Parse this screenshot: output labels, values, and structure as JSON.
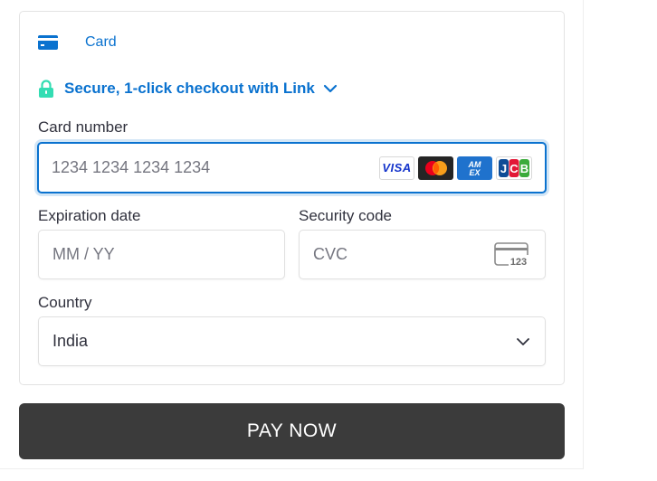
{
  "payment_method": {
    "tab_label": "Card",
    "icon": "credit-card-icon"
  },
  "link": {
    "label": "Secure, 1-click checkout with Link",
    "icon": "lock-icon",
    "expand_icon": "chevron-down-icon"
  },
  "card_number": {
    "label": "Card number",
    "placeholder": "1234 1234 1234 1234",
    "brands": [
      "VISA",
      "Mastercard",
      "American Express",
      "JCB"
    ],
    "brand_texts": {
      "visa": "VISA",
      "amex_top": "AM",
      "amex_bottom": "EX",
      "jcb_j": "J",
      "jcb_c": "C",
      "jcb_b": "B"
    }
  },
  "expiration": {
    "label": "Expiration date",
    "placeholder": "MM / YY"
  },
  "security_code": {
    "label": "Security code",
    "placeholder": "CVC",
    "icon_text": "123"
  },
  "country": {
    "label": "Country",
    "value": "India"
  },
  "pay_button": {
    "label": "PAY NOW"
  },
  "colors": {
    "accent": "#0a72cf",
    "button_bg": "#3b3b3b",
    "text": "#30313d",
    "placeholder": "#757680"
  }
}
